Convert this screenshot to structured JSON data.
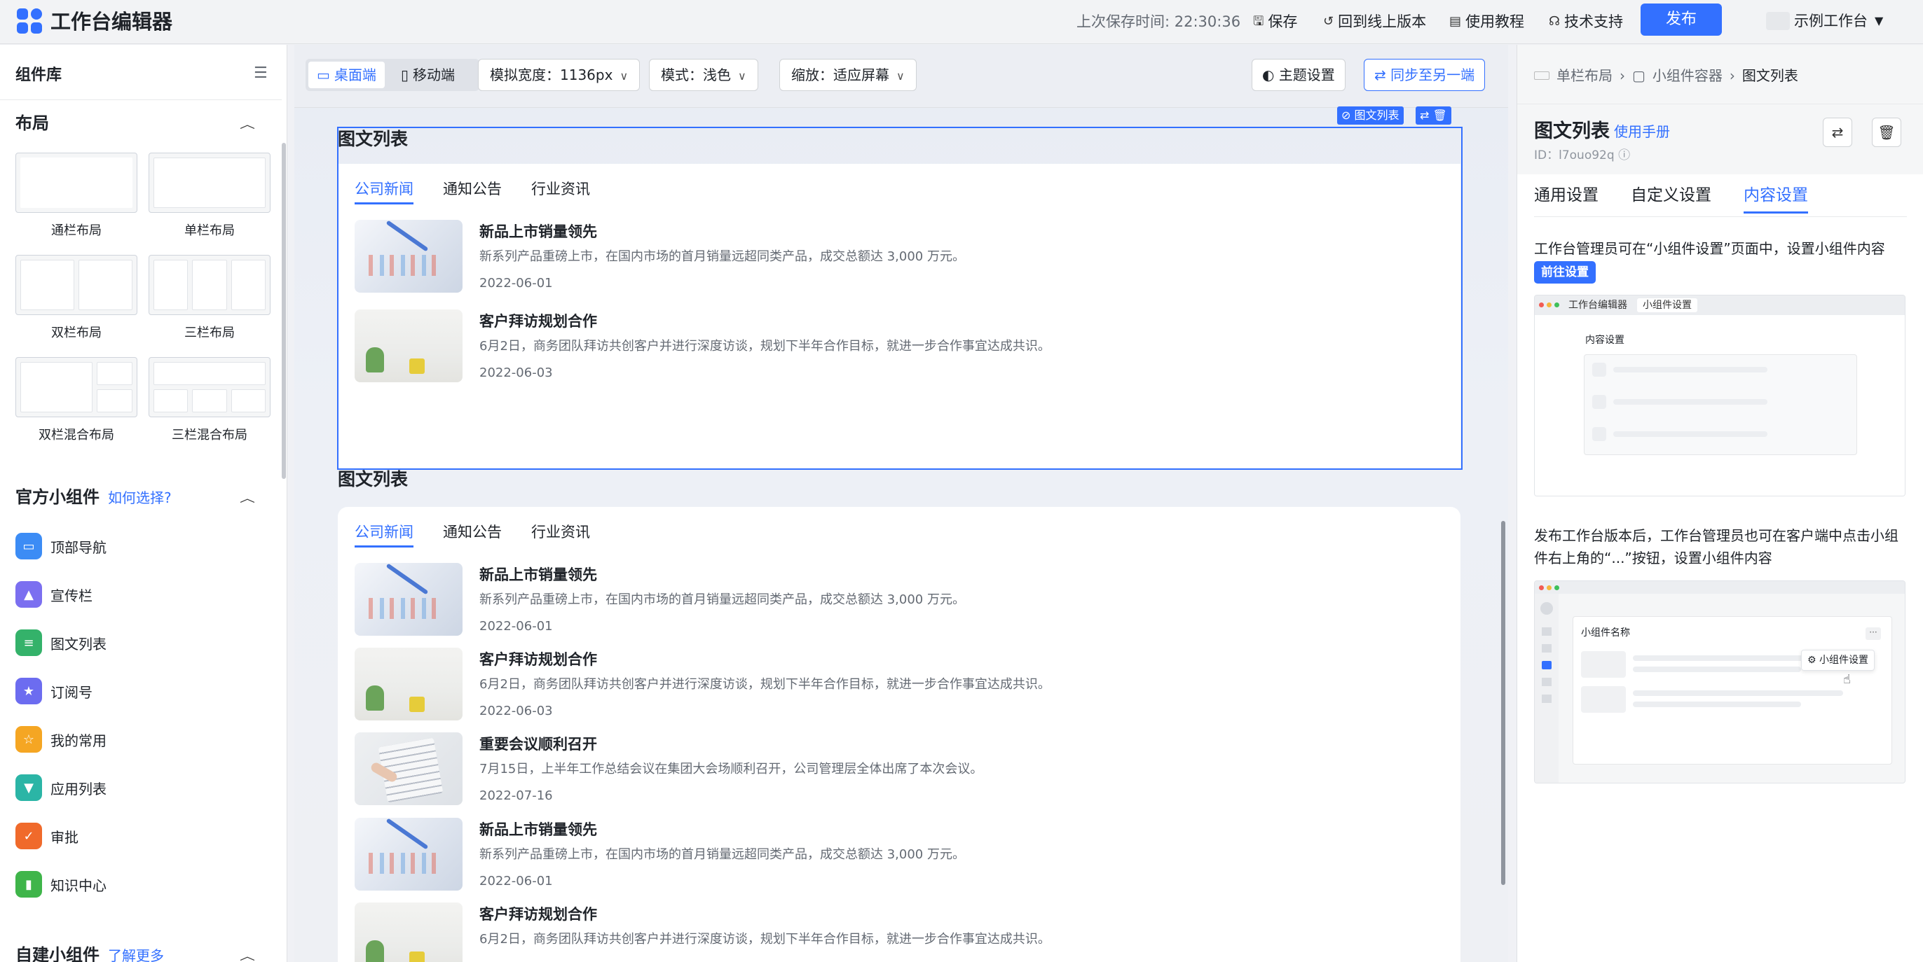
{
  "header": {
    "app_title": "工作台编辑器",
    "save_time": "上次保存时间: 22:30:36",
    "save": "保存",
    "rollback": "回到线上版本",
    "tutorial": "使用教程",
    "support": "技术支持",
    "publish": "发布",
    "workspace": "示例工作台"
  },
  "sidebar": {
    "title": "组件库",
    "layout_section": "布局",
    "layouts": [
      "通栏布局",
      "单栏布局",
      "双栏布局",
      "三栏布局",
      "双栏混合布局",
      "三栏混合布局"
    ],
    "official_section": "官方小组件",
    "official_link": "如何选择?",
    "widgets": [
      {
        "label": "顶部导航",
        "color": "#3c8cf5"
      },
      {
        "label": "宣传栏",
        "color": "#7b6ff0"
      },
      {
        "label": "图文列表",
        "color": "#34b26a"
      },
      {
        "label": "订阅号",
        "color": "#6c6cf0"
      },
      {
        "label": "我的常用",
        "color": "#f5a623"
      },
      {
        "label": "应用列表",
        "color": "#2bb5a6"
      },
      {
        "label": "审批",
        "color": "#f06a2b"
      },
      {
        "label": "知识中心",
        "color": "#3fb54a"
      }
    ],
    "custom_section": "自建小组件",
    "custom_link": "了解更多"
  },
  "toolbar": {
    "desktop": "桌面端",
    "mobile": "移动端",
    "width": "模拟宽度：1136px",
    "mode": "模式：浅色",
    "zoom": "缩放：适应屏幕",
    "theme": "主题设置",
    "sync": "同步至另一端"
  },
  "canvas": {
    "selected_tag": "图文列表",
    "widget1": {
      "title": "图文列表",
      "tabs": [
        "公司新闻",
        "通知公告",
        "行业资讯"
      ],
      "items": [
        {
          "title": "新品上市销量领先",
          "desc": "新系列产品重磅上市，在国内市场的首月销量远超同类产品，成交总额达 3,000 万元。",
          "date": "2022-06-01"
        },
        {
          "title": "客户拜访规划合作",
          "desc": "6月2日，商务团队拜访共创客户并进行深度访谈，规划下半年合作目标，就进一步合作事宜达成共识。",
          "date": "2022-06-03"
        }
      ]
    },
    "widget2": {
      "title": "图文列表",
      "tabs": [
        "公司新闻",
        "通知公告",
        "行业资讯"
      ],
      "items": [
        {
          "title": "新品上市销量领先",
          "desc": "新系列产品重磅上市，在国内市场的首月销量远超同类产品，成交总额达 3,000 万元。",
          "date": "2022-06-01"
        },
        {
          "title": "客户拜访规划合作",
          "desc": "6月2日，商务团队拜访共创客户并进行深度访谈，规划下半年合作目标，就进一步合作事宜达成共识。",
          "date": "2022-06-03"
        },
        {
          "title": "重要会议顺利召开",
          "desc": "7月15日，上半年工作总结会议在集团大会场顺利召开，公司管理层全体出席了本次会议。",
          "date": "2022-07-16"
        },
        {
          "title": "新品上市销量领先",
          "desc": "新系列产品重磅上市，在国内市场的首月销量远超同类产品，成交总额达 3,000 万元。",
          "date": "2022-06-01"
        },
        {
          "title": "客户拜访规划合作",
          "desc": "6月2日，商务团队拜访共创客户并进行深度访谈，规划下半年合作目标，就进一步合作事宜达成共识。",
          "date": ""
        }
      ]
    }
  },
  "panel": {
    "breadcrumb": [
      "单栏布局",
      "小组件容器",
      "图文列表"
    ],
    "title": "图文列表",
    "manual": "使用手册",
    "id": "ID：l7ouo92q",
    "tabs": [
      "通用设置",
      "自定义设置",
      "内容设置"
    ],
    "text1": "工作台管理员可在“小组件设置”页面中，设置小组件内容",
    "go_button": "前往设置",
    "shot1_tabs": [
      "工作台编辑器",
      "小组件设置"
    ],
    "shot1_label": "内容设置",
    "text2": "发布工作台版本后，工作台管理员也可在客户端中点击小组件右上角的“...”按钮，设置小组件内容",
    "shot2_label": "小组件名称",
    "shot2_popup": "小组件设置"
  }
}
